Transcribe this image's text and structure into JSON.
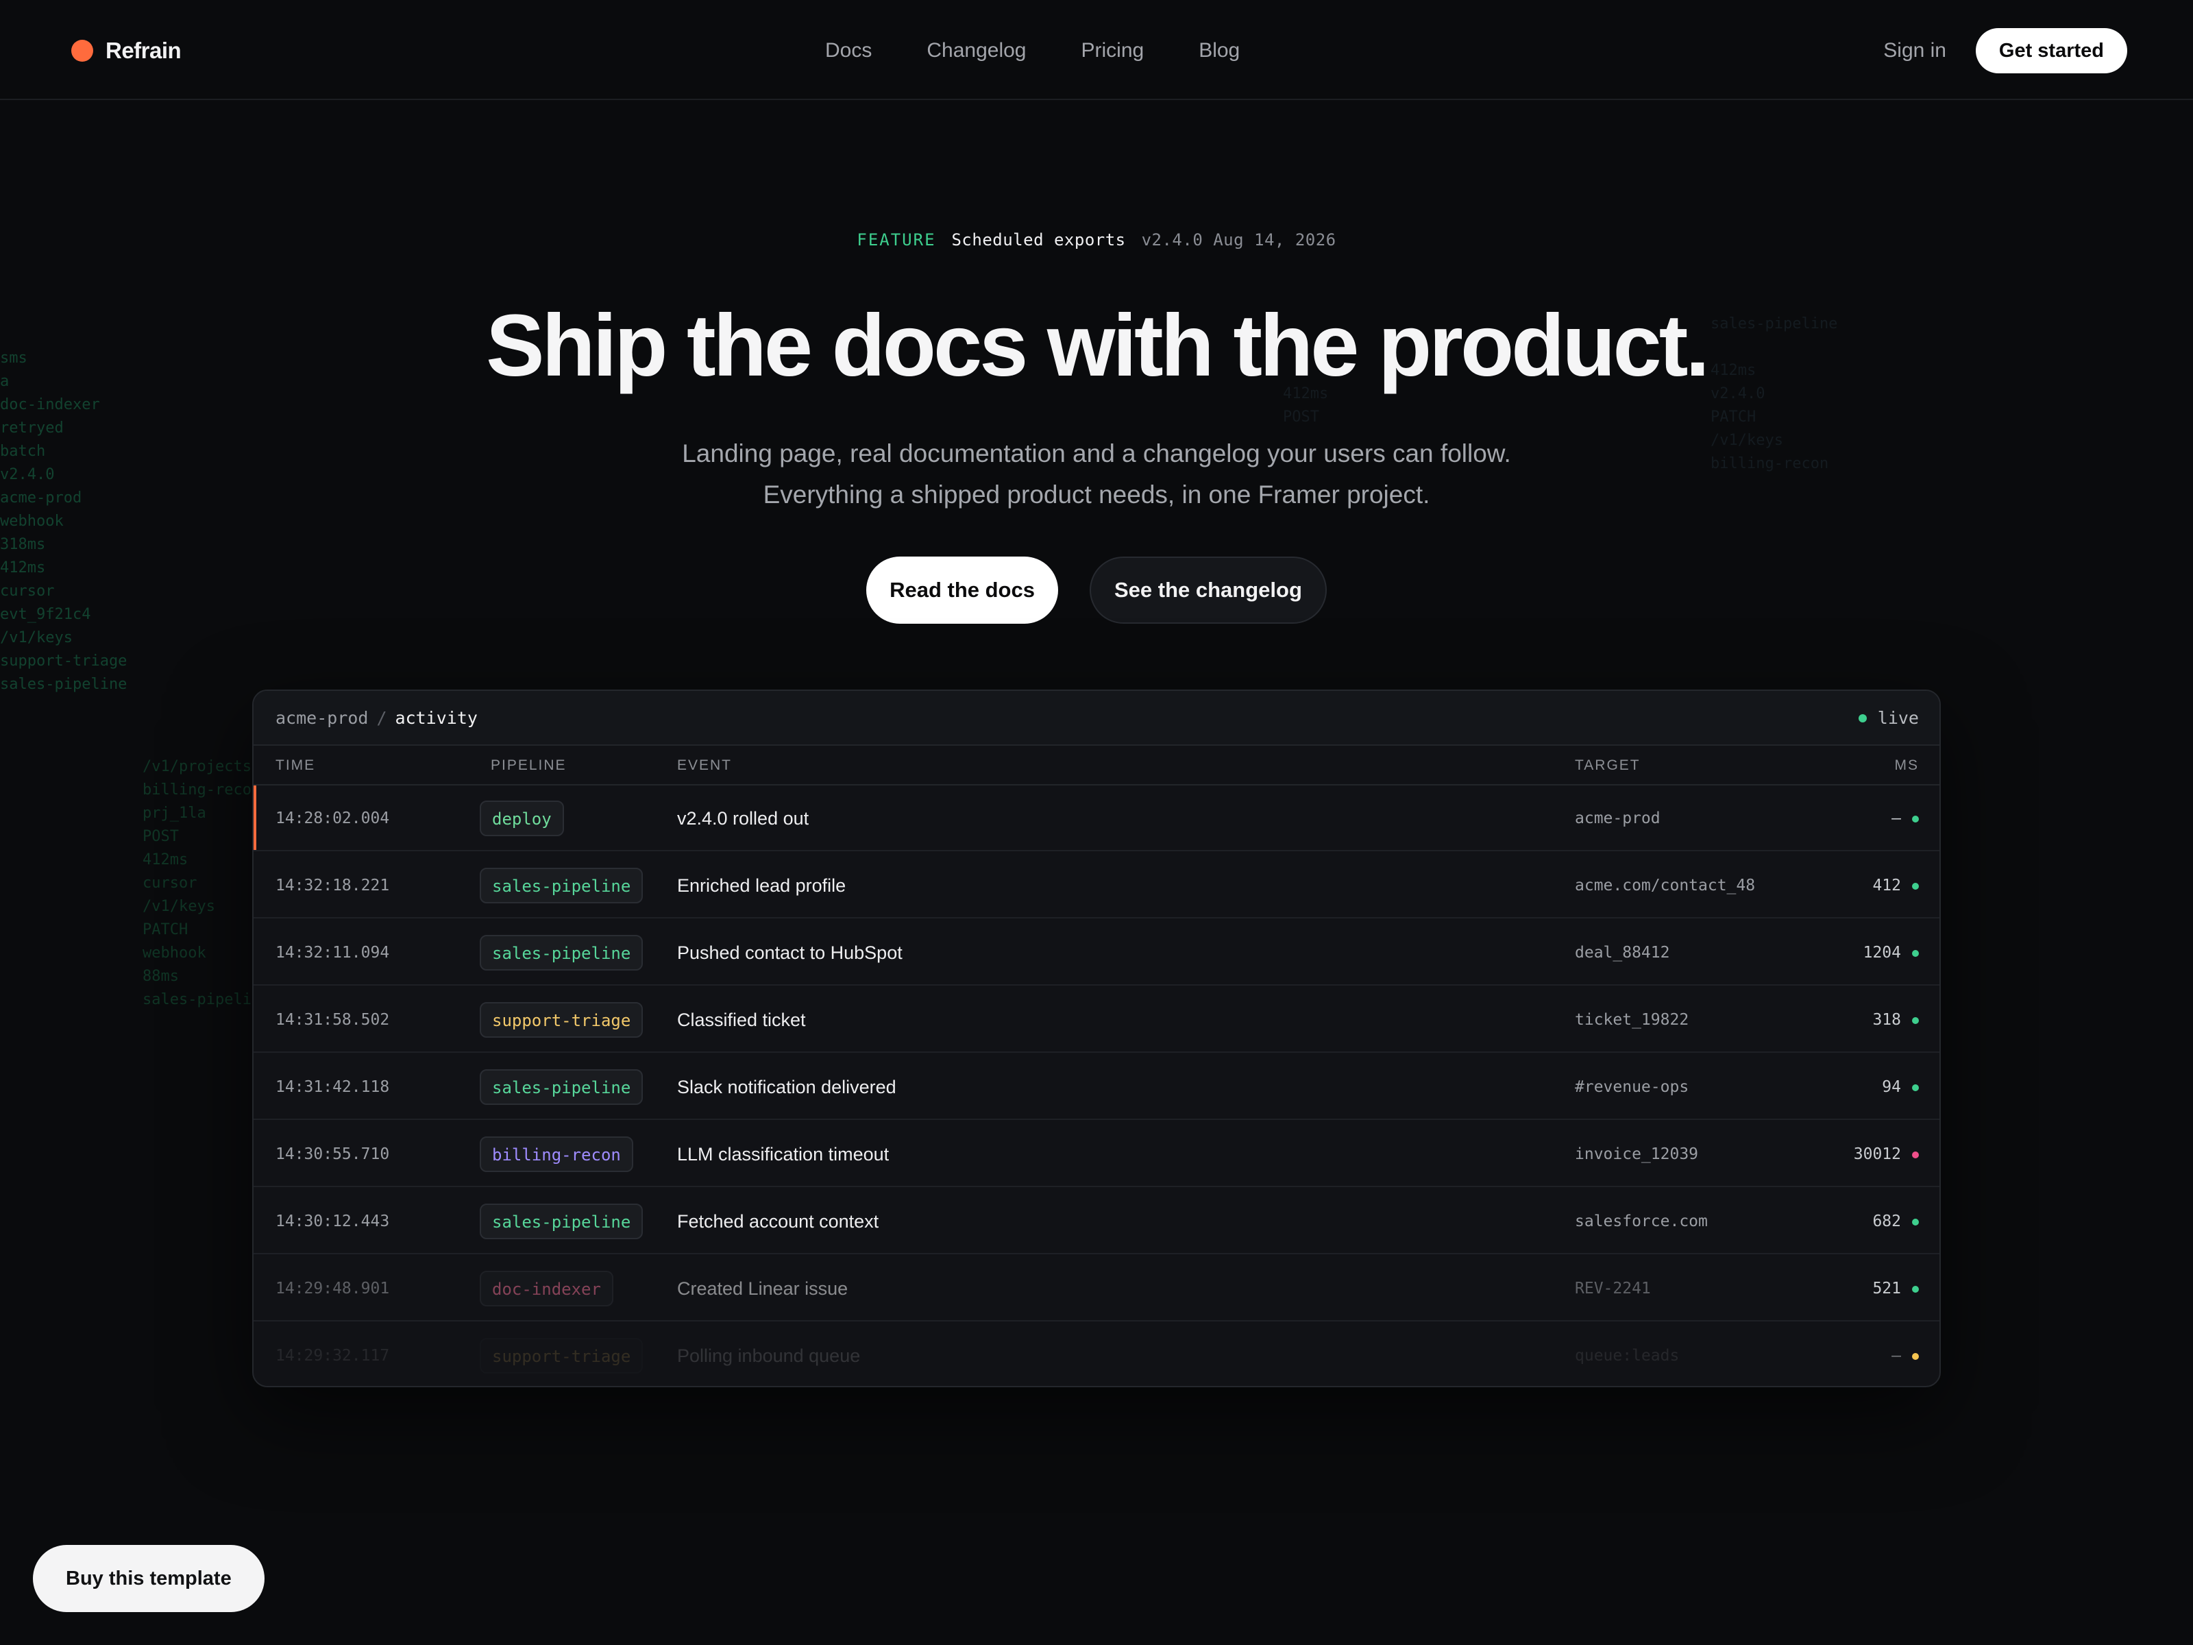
{
  "nav": {
    "brand": "Refrain",
    "links": [
      "Docs",
      "Changelog",
      "Pricing",
      "Blog"
    ],
    "sign_in": "Sign in",
    "get_started": "Get started"
  },
  "release": {
    "tag": "FEATURE",
    "name": "Scheduled exports",
    "version": "v2.4.0",
    "date": "Aug 14, 2026"
  },
  "hero": {
    "title": "Ship the docs with the product.",
    "subtitle_line1": "Landing page, real documentation and a changelog your users can follow.",
    "subtitle_line2": "Everything a shipped product needs, in one Framer project.",
    "cta_primary": "Read the docs",
    "cta_secondary": "See the changelog"
  },
  "background_code": {
    "left": [
      "sms",
      "a",
      "doc-indexer",
      "retryed",
      "batch",
      "v2.4.0",
      "acme-prod",
      "webhook",
      "318ms",
      "412ms",
      "cursor",
      "evt_9f21c4",
      "/v1/keys",
      "support-triage",
      "sales-pipeline"
    ],
    "left2": [
      "",
      "/v1/projects",
      "billing-recon",
      "prj_1la",
      "POST",
      "412ms",
      "cursor",
      "/v1/keys",
      "PATCH",
      "webhook",
      "88ms",
      "sales-pipeline"
    ],
    "right1": [
      "",
      "",
      "",
      "",
      "",
      "",
      "",
      "",
      "412ms",
      "POST",
      "",
      ""
    ],
    "right2": [
      "",
      "",
      "",
      "sales-pipeline",
      "",
      "412ms",
      "v2.4.0",
      "PATCH",
      "/v1/keys",
      "billing-recon"
    ]
  },
  "panel": {
    "org": "acme-prod",
    "separator": "/",
    "page": "activity",
    "status": "live",
    "columns": [
      "TIME",
      "PIPELINE",
      "EVENT",
      "TARGET",
      "MS"
    ],
    "rows": [
      {
        "time": "14:28:02.004",
        "pipeline": "deploy",
        "event": "v2.4.0 rolled out",
        "target": "acme-prod",
        "ms": "—"
      },
      {
        "time": "14:32:18.221",
        "pipeline": "sales-pipeline",
        "event": "Enriched lead profile",
        "target": "acme.com/contact_48",
        "ms": "412"
      },
      {
        "time": "14:32:11.094",
        "pipeline": "sales-pipeline",
        "event": "Pushed contact to HubSpot",
        "target": "deal_88412",
        "ms": "1204"
      },
      {
        "time": "14:31:58.502",
        "pipeline": "support-triage",
        "event": "Classified ticket",
        "target": "ticket_19822",
        "ms": "318"
      },
      {
        "time": "14:31:42.118",
        "pipeline": "sales-pipeline",
        "event": "Slack notification delivered",
        "target": "#revenue-ops",
        "ms": "94"
      },
      {
        "time": "14:30:55.710",
        "pipeline": "billing-recon",
        "event": "LLM classification timeout",
        "target": "invoice_12039",
        "ms": "30012"
      },
      {
        "time": "14:30:12.443",
        "pipeline": "sales-pipeline",
        "event": "Fetched account context",
        "target": "salesforce.com",
        "ms": "682"
      },
      {
        "time": "14:29:48.901",
        "pipeline": "doc-indexer",
        "event": "Created Linear issue",
        "target": "REV-2241",
        "ms": "521"
      },
      {
        "time": "14:29:32.117",
        "pipeline": "support-triage",
        "event": "Polling inbound queue",
        "target": "queue:leads",
        "ms": "—"
      }
    ]
  },
  "colors": {
    "accent": "#ff6b3d",
    "ok": "#3ecf8e",
    "error": "#ef4f8a",
    "warn": "#f5c451",
    "pipeline_deploy": "#6fdc9c",
    "pipeline_sales": "#57d69a",
    "pipeline_support": "#f2c86a",
    "pipeline_billing": "#9f8cff",
    "pipeline_doc": "#e26a8d"
  },
  "buy_button": "Buy this template"
}
